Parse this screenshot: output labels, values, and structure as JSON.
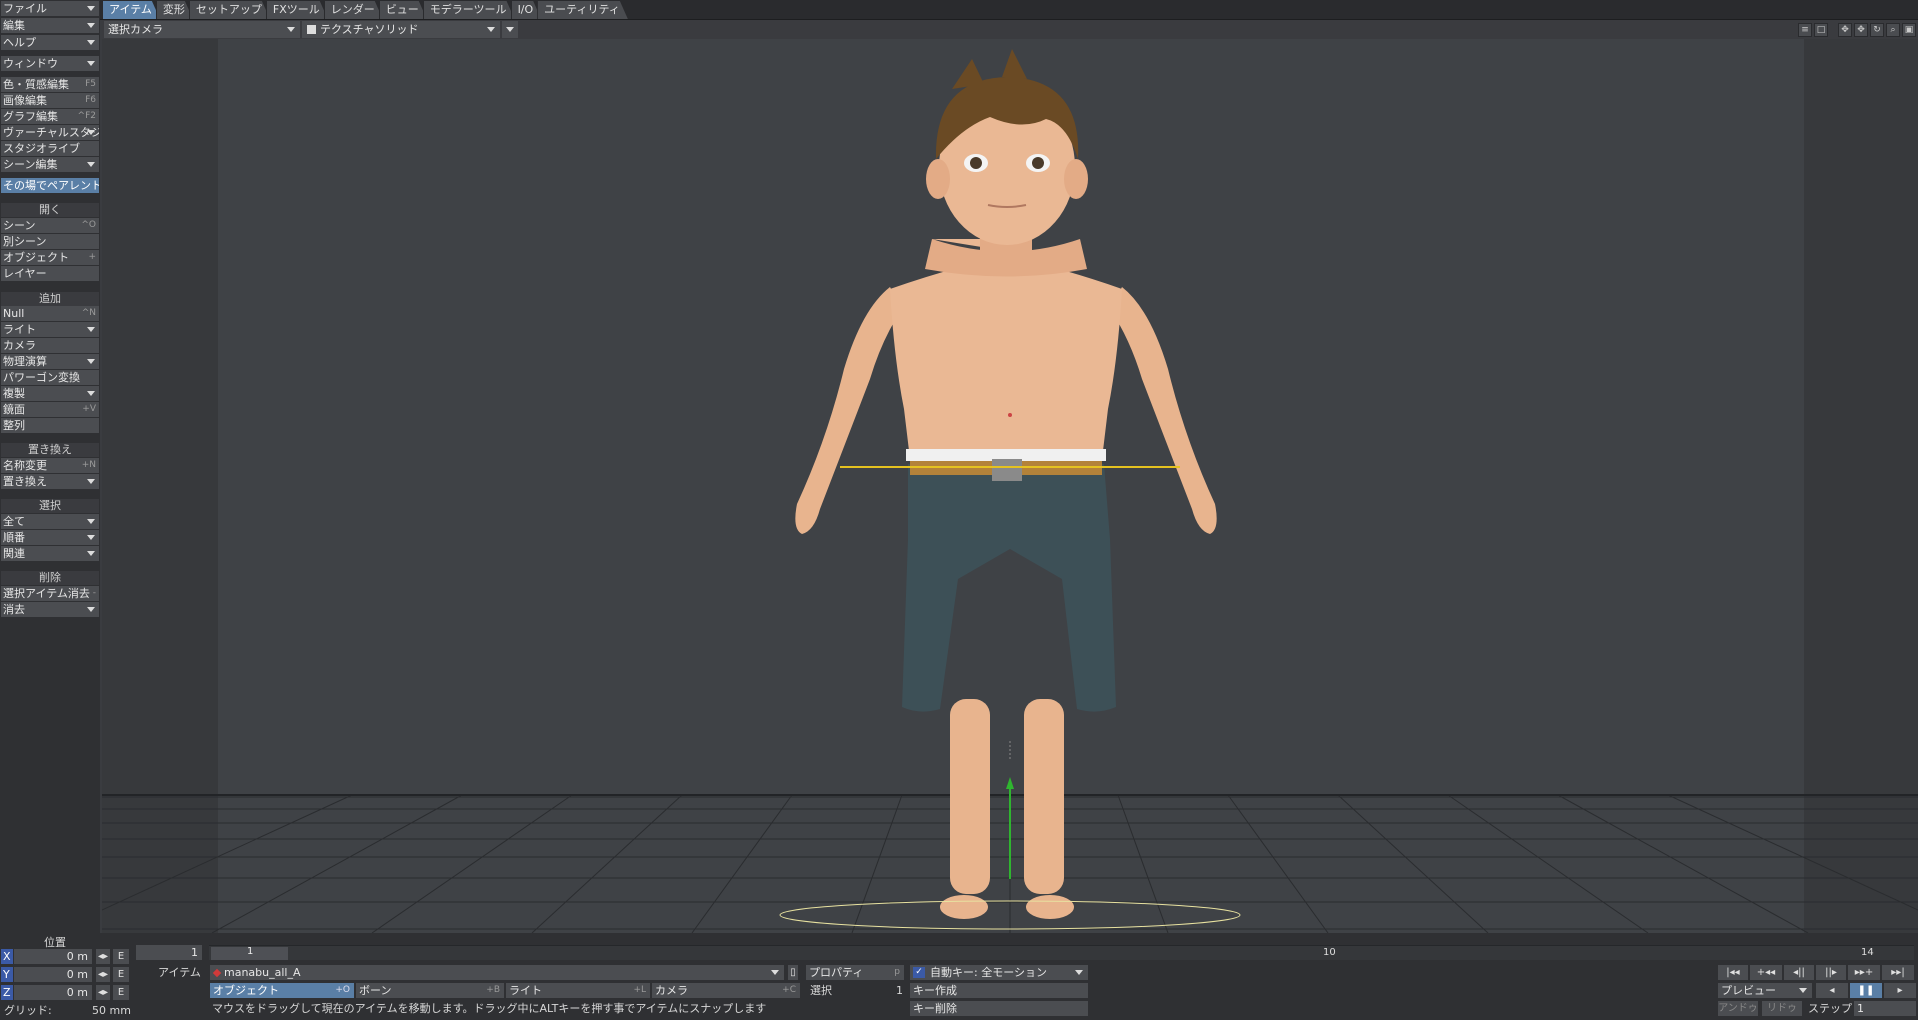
{
  "tabs": [
    "アイテム",
    "変形",
    "セットアップ",
    "FXツール",
    "レンダー",
    "ビュー",
    "モデラーツール",
    "I/O",
    "ユーティリティ"
  ],
  "sidebar": {
    "menus": [
      "ファイル",
      "編集",
      "ヘルプ"
    ],
    "window": "ウィンドウ",
    "editors": [
      {
        "label": "色・質感編集",
        "sc": "F5"
      },
      {
        "label": "画像編集",
        "sc": "F6"
      },
      {
        "label": "グラフ編集",
        "sc": "^F2"
      },
      {
        "label": "ヴァーチャルスタジオ",
        "sc": ""
      },
      {
        "label": "スタジオライブ",
        "sc": ""
      },
      {
        "label": "シーン編集",
        "sc": ""
      }
    ],
    "highlight": "その場でペアレント",
    "open_header": "開く",
    "open_items": [
      {
        "label": "シーン",
        "sc": "^O"
      },
      {
        "label": "別シーン",
        "sc": ""
      },
      {
        "label": "オブジェクト",
        "sc": "+"
      },
      {
        "label": "レイヤー",
        "sc": ""
      }
    ],
    "add_header": "追加",
    "add_items": [
      {
        "label": "Null",
        "sc": "^N"
      },
      {
        "label": "ライト",
        "sc": ""
      },
      {
        "label": "カメラ",
        "sc": ""
      },
      {
        "label": "物理演算",
        "sc": ""
      },
      {
        "label": "パワーゴン変換",
        "sc": ""
      },
      {
        "label": "複製",
        "sc": ""
      },
      {
        "label": "鏡面",
        "sc": "+V"
      },
      {
        "label": "整列",
        "sc": ""
      }
    ],
    "replace_header": "置き換え",
    "replace_items": [
      {
        "label": "名称変更",
        "sc": "+N"
      },
      {
        "label": "置き換え",
        "sc": ""
      }
    ],
    "select_header": "選択",
    "select_items": [
      "全て",
      "順番",
      "関連"
    ],
    "delete_header": "削除",
    "delete_items": [
      {
        "label": "選択アイテム消去",
        "sc": "-"
      },
      {
        "label": "消去",
        "sc": ""
      }
    ]
  },
  "viewport": {
    "camera_select": "選択カメラ",
    "render_mode": "テクスチャソリッド"
  },
  "position": {
    "header": "位置",
    "x_label": "X",
    "y_label": "Y",
    "z_label": "Z",
    "x": "0 m",
    "y": "0 m",
    "z": "0 m",
    "e": "E",
    "grid_label": "グリッド:",
    "grid_value": "50 mm"
  },
  "timeline": {
    "frame": "1",
    "marker": "1",
    "tick_10": "10",
    "tick_end": "14"
  },
  "item": {
    "label": "アイテム",
    "current": "manabu_all_A",
    "object_btn": "オブジェクト",
    "object_sc": "+O",
    "bone_btn": "ボーン",
    "bone_sc": "+B",
    "light_btn": "ライト",
    "light_sc": "+L",
    "camera_btn": "カメラ",
    "camera_sc": "+C"
  },
  "properties": {
    "label": "プロパティ",
    "sc": "p",
    "select_label": "選択",
    "select_value": "1"
  },
  "autokey": {
    "label": "自動キー: 全モーション",
    "create_key": "キー作成",
    "delete_key": "キー削除"
  },
  "status": "マウスをドラッグして現在のアイテムを移動します。ドラッグ中にALTキーを押す事でアイテムにスナップします",
  "playback": {
    "preview": "プレビュー",
    "step_label": "ステップ",
    "step_value": "1",
    "btn_a": "アンドゥ",
    "btn_b": "リドゥ"
  }
}
